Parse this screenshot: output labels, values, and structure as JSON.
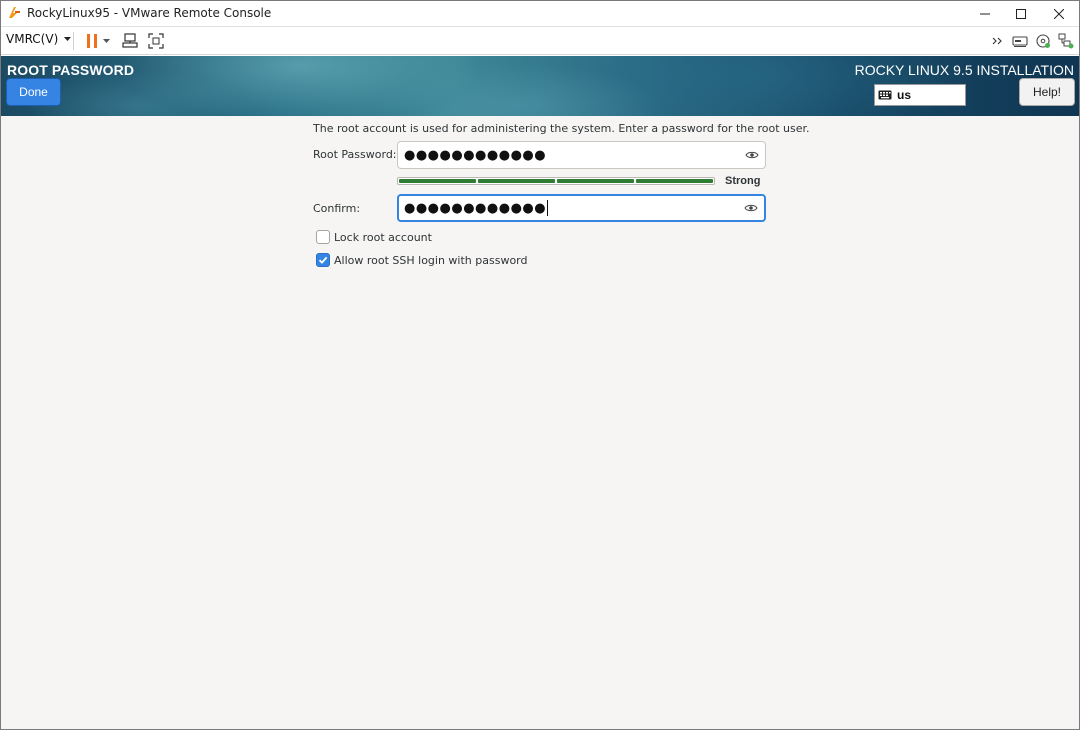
{
  "window": {
    "title": "RockyLinux95 - VMware Remote Console"
  },
  "toolbar": {
    "menu_label": "VMRC(V)"
  },
  "header": {
    "title": "ROOT PASSWORD",
    "done_label": "Done",
    "product": "ROCKY LINUX 9.5 INSTALLATION",
    "keyboard_layout": "us",
    "help_label": "Help!"
  },
  "form": {
    "intro": "The root account is used for administering the system.  Enter a password for the root user.",
    "root_password_label": "Root Password:",
    "root_password_value": "●●●●●●●●●●●●",
    "strength_label": "Strong",
    "strength_level": 1.0,
    "confirm_label": "Confirm:",
    "confirm_value": "●●●●●●●●●●●●",
    "lock_root_label": "Lock root account",
    "lock_root_checked": false,
    "allow_ssh_label": "Allow root SSH login with password",
    "allow_ssh_checked": true
  },
  "colors": {
    "accent": "#3584e4",
    "strength_green": "#2e7d32",
    "pause_orange": "#f07020",
    "content_bg": "#f6f5f4"
  },
  "icons": [
    "vmware-icon",
    "pause-icon",
    "send-ctrl-alt-del-icon",
    "fullscreen-icon",
    "chevron-forward-icon",
    "removable-devices-icon",
    "settings-disc-icon",
    "network-icon",
    "keyboard-icon",
    "eye-icon",
    "checkmark-icon"
  ]
}
